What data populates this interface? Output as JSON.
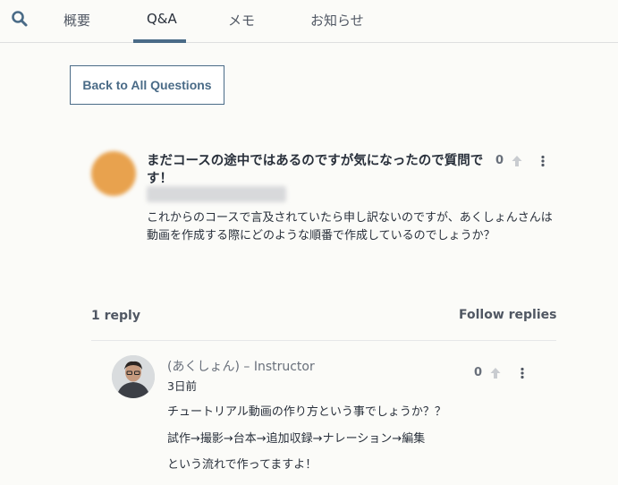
{
  "tabs": {
    "overview": "概要",
    "qa": "Q&A",
    "memo": "メモ",
    "notice": "お知らせ"
  },
  "back_button": "Back to All Questions",
  "question": {
    "title": "まだコースの途中ではあるのですが気になったので質問です！",
    "body": "これからのコースで言及されていたら申し訳ないのですが、あくしょんさんは動画を作成する際にどのような順番で作成しているのでしょうか？",
    "votes": "0"
  },
  "replies_header": {
    "count": "1 reply",
    "follow": "Follow replies"
  },
  "reply": {
    "author": "(あくしょん) – Instructor",
    "time": "3日前",
    "votes": "0",
    "lines": [
      "チュートリアル動画の作り方という事でしょうか？？",
      "試作→撮影→台本→追加収録→ナレーション→編集",
      "という流れで作ってますよ！"
    ]
  },
  "colors": {
    "accent": "#4a6b87",
    "background": "#fbfbf8",
    "question_avatar": "#e8a24e"
  },
  "icons": {
    "search": "search-icon",
    "upvote": "arrow-up-icon",
    "menu": "kebab-menu-icon"
  }
}
